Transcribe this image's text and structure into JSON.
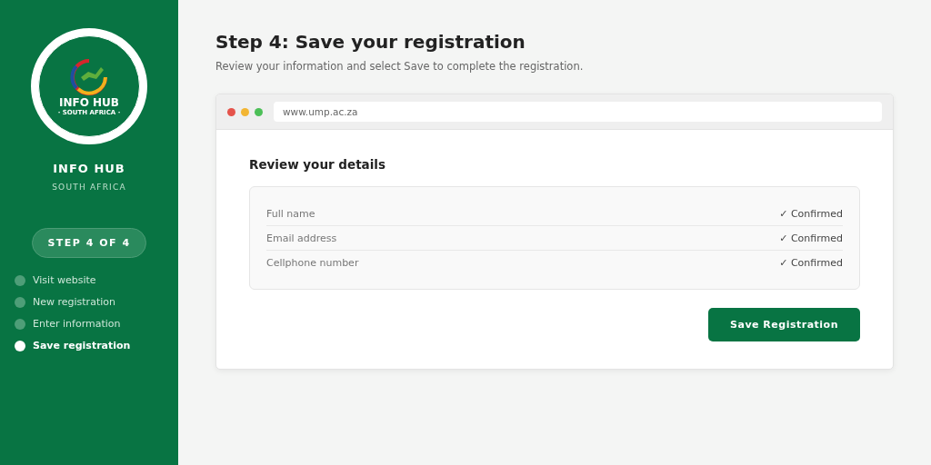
{
  "sidebar": {
    "logo": {
      "title": "INFO HUB",
      "subtitle": "· SOUTH AFRICA ·"
    },
    "brand": "INFO HUB",
    "tagline": "SOUTH AFRICA",
    "step_badge": "STEP 4 OF 4",
    "steps": [
      {
        "label": "Visit website",
        "selected": false
      },
      {
        "label": "New registration",
        "selected": false
      },
      {
        "label": "Enter information",
        "selected": false
      },
      {
        "label": "Save registration",
        "selected": true
      }
    ]
  },
  "header": {
    "title": "Step 4: Save your registration",
    "subtitle": "Review your information and select Save to complete the registration."
  },
  "browser": {
    "url": "www.ump.ac.za",
    "section_title": "Review your details",
    "details": [
      {
        "label": "Full name",
        "status": "✓ Confirmed"
      },
      {
        "label": "Email address",
        "status": "✓ Confirmed"
      },
      {
        "label": "Cellphone number",
        "status": "✓ Confirmed"
      }
    ],
    "save_button": "Save Registration"
  }
}
